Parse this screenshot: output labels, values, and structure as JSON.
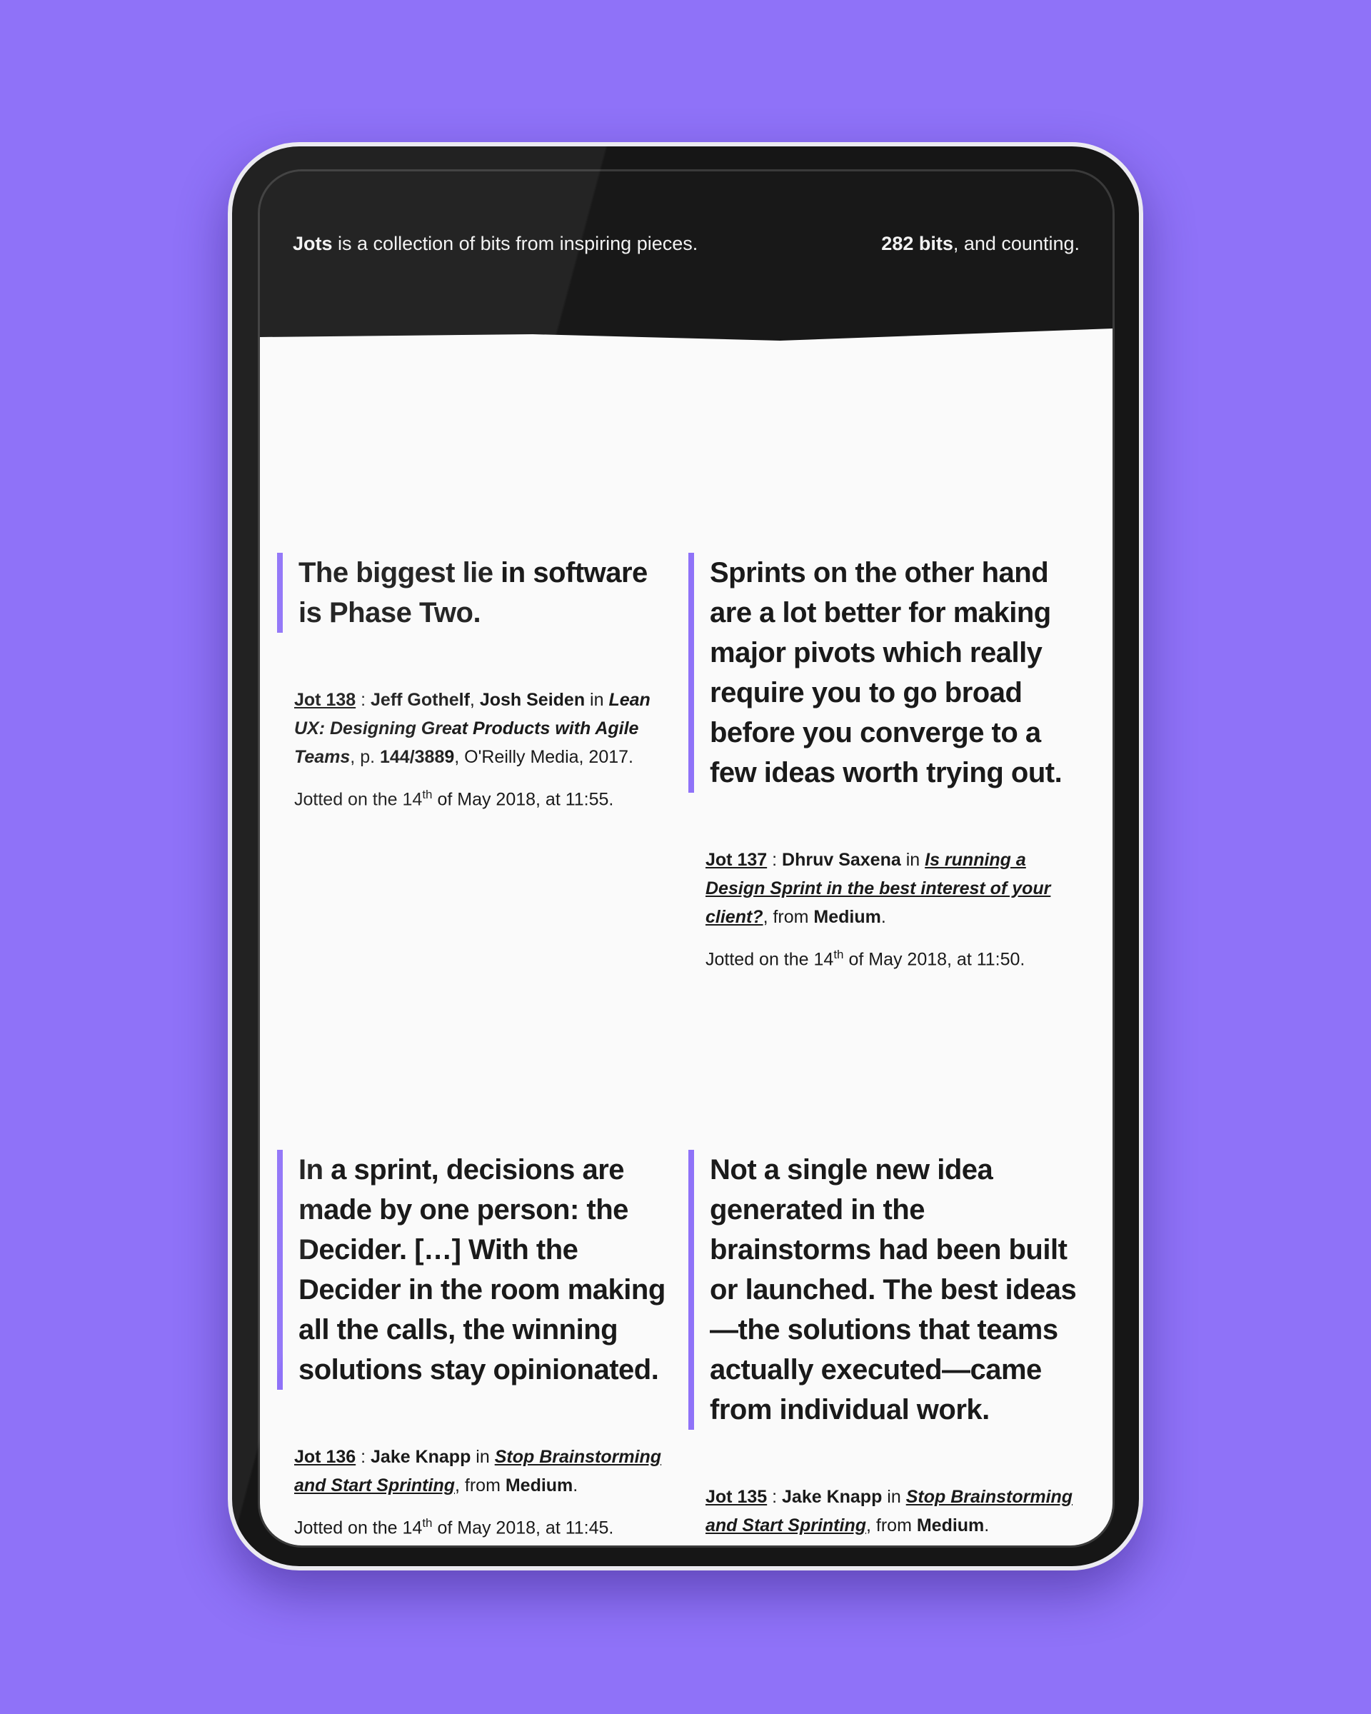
{
  "header": {
    "brand": "Jots",
    "tagline": " is a collection of bits from inspiring pieces.",
    "count": "282 bits",
    "count_suffix": ", and counting."
  },
  "jots": [
    {
      "quote": "The biggest lie in software is Phase Two.",
      "jot_label": "Jot 138",
      "sep": " : ",
      "author1": "Jeff Gothelf",
      "comma": ", ",
      "author2": "Josh Seiden",
      "in": " in ",
      "source": "Lean UX: Designing Great Products with Agile Teams",
      "page_prefix": ", p. ",
      "page": "144/3889",
      "publisher": ", O'Reilly Media, 2017.",
      "date_prefix": "Jotted on the 14",
      "date_sup": "th",
      "date_suffix": " of May 2018, at 11:55."
    },
    {
      "quote": "Sprints on the other hand are a lot better for making major pivots which really require you to go broad before you converge to a few ideas worth trying out.",
      "jot_label": "Jot 137",
      "sep": " : ",
      "author": "Dhruv Saxena",
      "in": " in ",
      "source": "Is running a Design Sprint in the best interest of your client?",
      "from": ", from ",
      "publisher": "Medium",
      "end": ".",
      "date_prefix": "Jotted on the 14",
      "date_sup": "th",
      "date_suffix": " of May 2018, at 11:50."
    },
    {
      "quote": "In a sprint, decisions are made by one person: the Decider. […] With the Decider in the room making all the calls, the winning solutions stay opinionated.",
      "jot_label": "Jot 136",
      "sep": " : ",
      "author": "Jake Knapp",
      "in": " in ",
      "source": "Stop Brainstorming and Start Sprinting",
      "from": ", from ",
      "publisher": "Medium",
      "end": ".",
      "date_prefix": "Jotted on the 14",
      "date_sup": "th",
      "date_suffix": " of May 2018, at 11:45."
    },
    {
      "quote": "Not a single new idea generated in the brainstorms had been built or launched. The best ideas—the solutions that teams actually executed—came from individual work.",
      "jot_label": "Jot 135",
      "sep": " : ",
      "author": "Jake Knapp",
      "in": " in ",
      "source": "Stop Brainstorming and Start Sprinting",
      "from": ", from ",
      "publisher": "Medium",
      "end": "."
    }
  ]
}
